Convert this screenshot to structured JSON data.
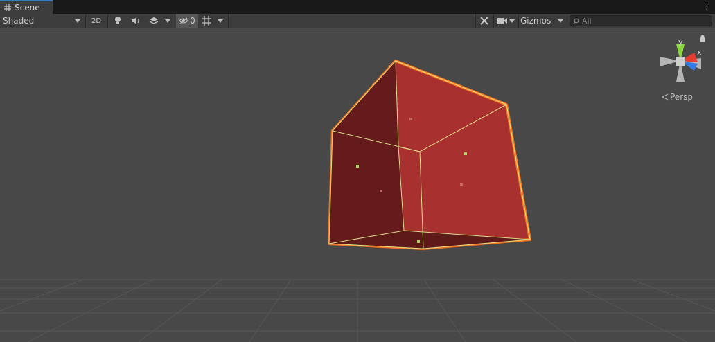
{
  "window": {
    "tab_label": "Scene",
    "tab_icon": "scene-grid-icon",
    "menu_icon": "kebab-menu-icon"
  },
  "toolbar": {
    "draw_mode": "Shaded",
    "mode_2d": "2D",
    "hidden_count": "0",
    "gizmos_label": "Gizmos",
    "search_placeholder": "All"
  },
  "gizmo": {
    "y_label": "y",
    "x_label": "x",
    "projection_label": "Persp"
  },
  "colors": {
    "accent": "#3a79bb",
    "cube_front": "#a8302f",
    "cube_side": "#651b1b",
    "selection_outline": "#f7761d",
    "wire": "#e6f095",
    "axis_x": "#e63b2e",
    "axis_y": "#8bd53f",
    "axis_z": "#3a7ae6"
  }
}
